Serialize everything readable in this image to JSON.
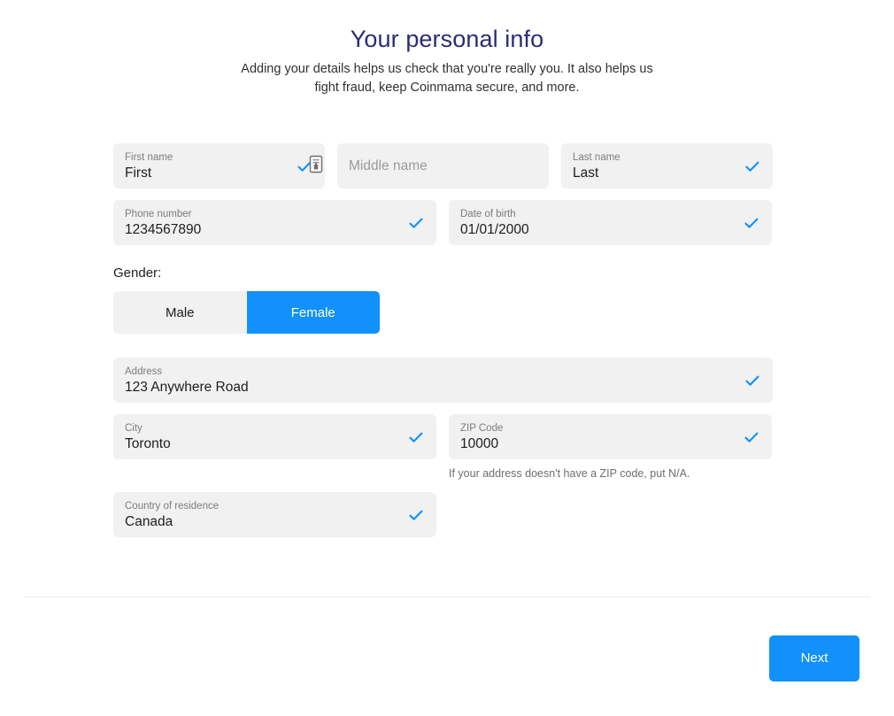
{
  "header": {
    "title": "Your personal info",
    "subtitle": "Adding your details helps us check that you're really you. It also helps us fight fraud, keep Coinmama secure, and more."
  },
  "colors": {
    "accent_blue": "#1290fc",
    "title_navy": "#2b2c74",
    "field_bg": "#f1f1f1",
    "label_gray": "#7c7c7c",
    "divider": "#ececec"
  },
  "form": {
    "first_name": {
      "label": "First name",
      "value": "First",
      "placeholder": "First name",
      "valid": true
    },
    "middle_name": {
      "label": "Middle name",
      "value": "",
      "placeholder": "Middle name",
      "valid": false
    },
    "last_name": {
      "label": "Last name",
      "value": "Last",
      "placeholder": "Last name",
      "valid": true
    },
    "phone_number": {
      "label": "Phone number",
      "value": "1234567890",
      "placeholder": "Phone number",
      "valid": true
    },
    "date_of_birth": {
      "label": "Date of birth",
      "value": "01/01/2000",
      "placeholder": "Date of birth",
      "valid": true
    },
    "gender": {
      "label": "Gender:",
      "options": [
        "Male",
        "Female"
      ],
      "selected": "Female"
    },
    "address": {
      "label": "Address",
      "value": "123 Anywhere Road",
      "placeholder": "Address",
      "valid": true
    },
    "city": {
      "label": "City",
      "value": "Toronto",
      "placeholder": "City",
      "valid": true
    },
    "zip_code": {
      "label": "ZIP Code",
      "value": "10000",
      "placeholder": "ZIP Code",
      "valid": true,
      "helper": "If your address doesn't have a ZIP code, put N/A."
    },
    "country_of_residence": {
      "label": "Country of residence",
      "value": "Canada",
      "placeholder": "Country of residence",
      "valid": true
    }
  },
  "footer": {
    "next_label": "Next"
  },
  "icons": {
    "check": "check-icon",
    "cursor": "text-document-cursor-icon"
  }
}
